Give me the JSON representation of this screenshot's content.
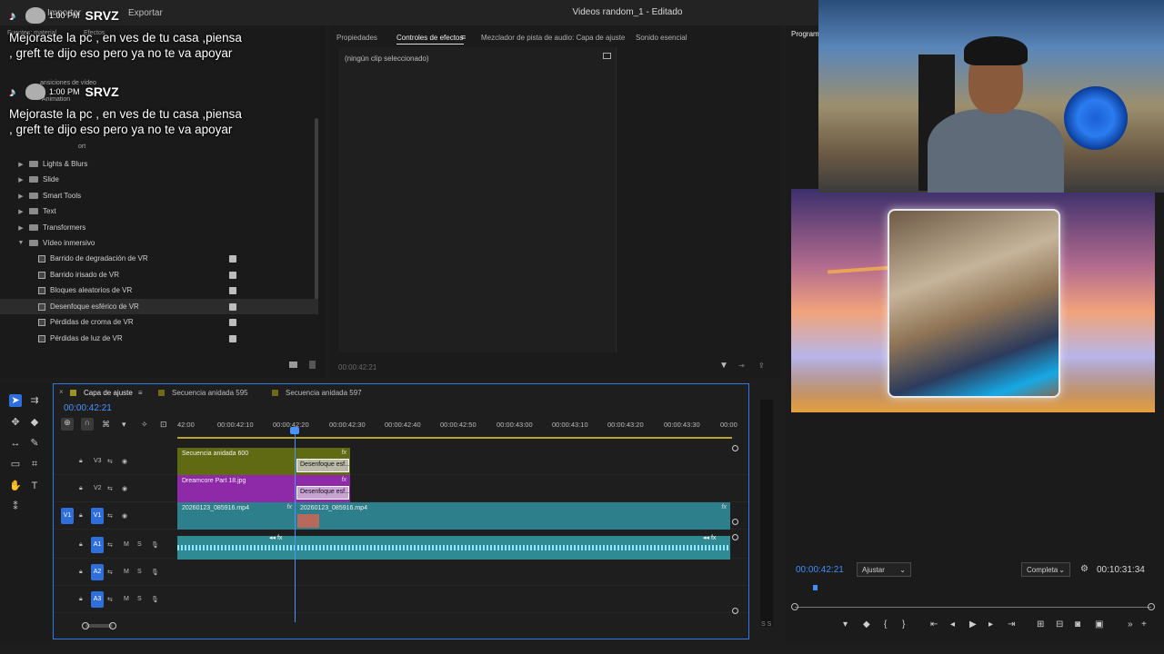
{
  "window": {
    "title": "Videos random_1 - Editado",
    "menu": [
      "Importar",
      "Exportar"
    ]
  },
  "effects_panel": {
    "tabs": [
      "Fuentes: material",
      "Efectos"
    ],
    "items": [
      {
        "label": "Lights & Blurs",
        "kind": "folder",
        "expanded": false
      },
      {
        "label": "Slide",
        "kind": "folder",
        "expanded": false
      },
      {
        "label": "Smart Tools",
        "kind": "folder",
        "expanded": false
      },
      {
        "label": "Text",
        "kind": "folder",
        "expanded": false
      },
      {
        "label": "Transformers",
        "kind": "folder",
        "expanded": false
      },
      {
        "label": "Vídeo inmersivo",
        "kind": "folder",
        "expanded": true
      },
      {
        "label": "Barrido de degradación de VR",
        "kind": "effect"
      },
      {
        "label": "Barrido irisado de VR",
        "kind": "effect"
      },
      {
        "label": "Bloques aleatorios de VR",
        "kind": "effect"
      },
      {
        "label": "Desenfoque esférico de VR",
        "kind": "effect",
        "selected": true
      },
      {
        "label": "Pérdidas de croma de VR",
        "kind": "effect"
      },
      {
        "label": "Pérdidas de luz de VR",
        "kind": "effect"
      }
    ],
    "partial_items": [
      "ansiciones de vídeo",
      "Animation",
      "ort"
    ]
  },
  "tiktok": {
    "time": "1:00 PM",
    "user": "SRVZ",
    "message": "Mejoraste la pc , en ves de tu casa ,piensa , greft te dijo eso pero ya no te va apoyar"
  },
  "effect_controls": {
    "tabs": [
      "Propiedades",
      "Controles de efectos",
      "Mezclador de pista de audio: Capa de ajuste",
      "Sonido esencial"
    ],
    "active_tab": "Controles de efectos",
    "empty_text": "(ningún clip seleccionado)",
    "timecode": "00:00:42:21"
  },
  "program": {
    "tab": "Programa",
    "timecode": "00:00:42:21",
    "duration": "00:10:31:34",
    "fit": "Ajustar",
    "quality": "Completa"
  },
  "timeline": {
    "tabs": [
      "Capa de ajuste",
      "Secuencia anidada 595",
      "Secuencia anidada 597"
    ],
    "timecode": "00:00:42:21",
    "ruler": [
      "42:00",
      "00:00:42:10",
      "00:00:42:20",
      "00:00:42:30",
      "00:00:42:40",
      "00:00:42:50",
      "00:00:43:00",
      "00:00:43:10",
      "00:00:43:20",
      "00:00:43:30",
      "00:00"
    ],
    "video_tracks": [
      "V3",
      "V2",
      "V1"
    ],
    "audio_tracks": [
      "A1",
      "A2",
      "A3"
    ],
    "source_v1": "V1",
    "clips": {
      "v3_a": "Secuencia anidada 600",
      "v3_b": "Desenfoque esf...",
      "v2_a": "Dreamcore Part 18.jpg",
      "v2_b": "Desenfoque esf...",
      "v1_a": "20260123_085916.mp4",
      "v1_b": "20260123_085916.mp4"
    },
    "track_letters": {
      "m": "M",
      "s": "S"
    },
    "meter_labels": "S S"
  },
  "colors": {
    "accent": "#2f6fdb",
    "timecode": "#4a93ff",
    "clip_olive": "#5f6a12",
    "clip_purple": "#8e2aa8",
    "clip_teal": "#2d7f8c"
  }
}
